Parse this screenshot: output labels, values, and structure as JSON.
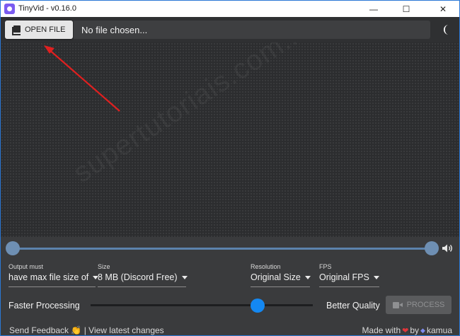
{
  "window": {
    "title": "TinyVid - v0.16.0",
    "minimize_glyph": "—",
    "maximize_glyph": "☐",
    "close_glyph": "✕"
  },
  "toolbar": {
    "open_label": "OPEN FILE",
    "file_status": "No file chosen...",
    "open_icon": "open-file-icon",
    "theme_icon": "moon-icon"
  },
  "watermark": "supertutoriais.com.br",
  "seek": {
    "start_fraction": 0.0,
    "end_fraction": 1.0,
    "volume_icon": "volume-icon"
  },
  "settings": {
    "output": {
      "label": "Output must",
      "value": "have max file size of"
    },
    "size": {
      "label": "Size",
      "value": "8 MB (Discord Free)"
    },
    "resolution": {
      "label": "Resolution",
      "value": "Original Size"
    },
    "fps": {
      "label": "FPS",
      "value": "Original FPS"
    }
  },
  "quality": {
    "left_label": "Faster Processing",
    "right_label": "Better Quality",
    "slider_fraction": 0.75
  },
  "process_label": "PROCESS",
  "footer": {
    "feedback": "Send Feedback 👏",
    "separator": "|",
    "changes": "View latest changes",
    "made_with": "Made with",
    "heart": "❤",
    "by": "by",
    "brand": "kamua"
  },
  "colors": {
    "accent": "#1488f2",
    "seek_track": "#5c83ad",
    "annotation_arrow": "#e02020"
  }
}
